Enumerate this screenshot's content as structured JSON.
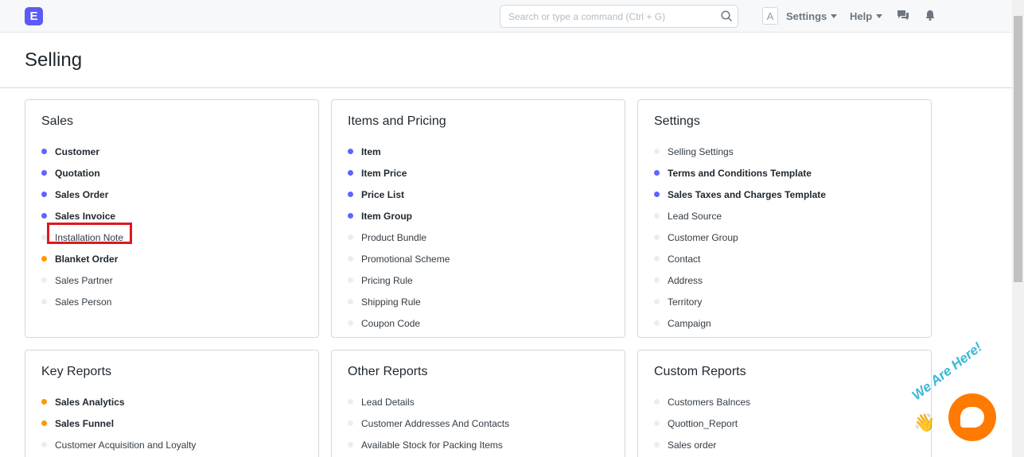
{
  "navbar": {
    "logo_letter": "E",
    "search_placeholder": "Search or type a command (Ctrl + G)",
    "avatar_letter": "A",
    "settings_label": "Settings",
    "help_label": "Help"
  },
  "page": {
    "title": "Selling"
  },
  "cards": [
    {
      "title": "Sales",
      "items": [
        {
          "label": "Customer",
          "dot": "blue"
        },
        {
          "label": "Quotation",
          "dot": "blue"
        },
        {
          "label": "Sales Order",
          "dot": "blue"
        },
        {
          "label": "Sales Invoice",
          "dot": "blue"
        },
        {
          "label": "Installation Note",
          "dot": "grey"
        },
        {
          "label": "Blanket Order",
          "dot": "orange"
        },
        {
          "label": "Sales Partner",
          "dot": "grey"
        },
        {
          "label": "Sales Person",
          "dot": "grey"
        }
      ]
    },
    {
      "title": "Items and Pricing",
      "items": [
        {
          "label": "Item",
          "dot": "blue"
        },
        {
          "label": "Item Price",
          "dot": "blue"
        },
        {
          "label": "Price List",
          "dot": "blue"
        },
        {
          "label": "Item Group",
          "dot": "blue"
        },
        {
          "label": "Product Bundle",
          "dot": "grey"
        },
        {
          "label": "Promotional Scheme",
          "dot": "grey"
        },
        {
          "label": "Pricing Rule",
          "dot": "grey"
        },
        {
          "label": "Shipping Rule",
          "dot": "grey"
        },
        {
          "label": "Coupon Code",
          "dot": "grey"
        }
      ]
    },
    {
      "title": "Settings",
      "items": [
        {
          "label": "Selling Settings",
          "dot": "grey"
        },
        {
          "label": "Terms and Conditions Template",
          "dot": "blue"
        },
        {
          "label": "Sales Taxes and Charges Template",
          "dot": "blue"
        },
        {
          "label": "Lead Source",
          "dot": "grey"
        },
        {
          "label": "Customer Group",
          "dot": "grey"
        },
        {
          "label": "Contact",
          "dot": "grey"
        },
        {
          "label": "Address",
          "dot": "grey"
        },
        {
          "label": "Territory",
          "dot": "grey"
        },
        {
          "label": "Campaign",
          "dot": "grey"
        }
      ]
    },
    {
      "title": "Key Reports",
      "items": [
        {
          "label": "Sales Analytics",
          "dot": "orange"
        },
        {
          "label": "Sales Funnel",
          "dot": "orange"
        },
        {
          "label": "Customer Acquisition and Loyalty",
          "dot": "grey"
        }
      ]
    },
    {
      "title": "Other Reports",
      "items": [
        {
          "label": "Lead Details",
          "dot": "grey"
        },
        {
          "label": "Customer Addresses And Contacts",
          "dot": "grey"
        },
        {
          "label": "Available Stock for Packing Items",
          "dot": "grey"
        }
      ]
    },
    {
      "title": "Custom Reports",
      "items": [
        {
          "label": "Customers Balnces",
          "dot": "grey"
        },
        {
          "label": "Quottion_Report",
          "dot": "grey"
        },
        {
          "label": "Sales order",
          "dot": "grey"
        }
      ]
    }
  ],
  "chat_widget": {
    "tagline": "We Are Here!"
  },
  "colors": {
    "accent": "#5e64ff",
    "warning": "#ff9800",
    "highlight": "#e1161f",
    "chat": "#ff7a00"
  }
}
